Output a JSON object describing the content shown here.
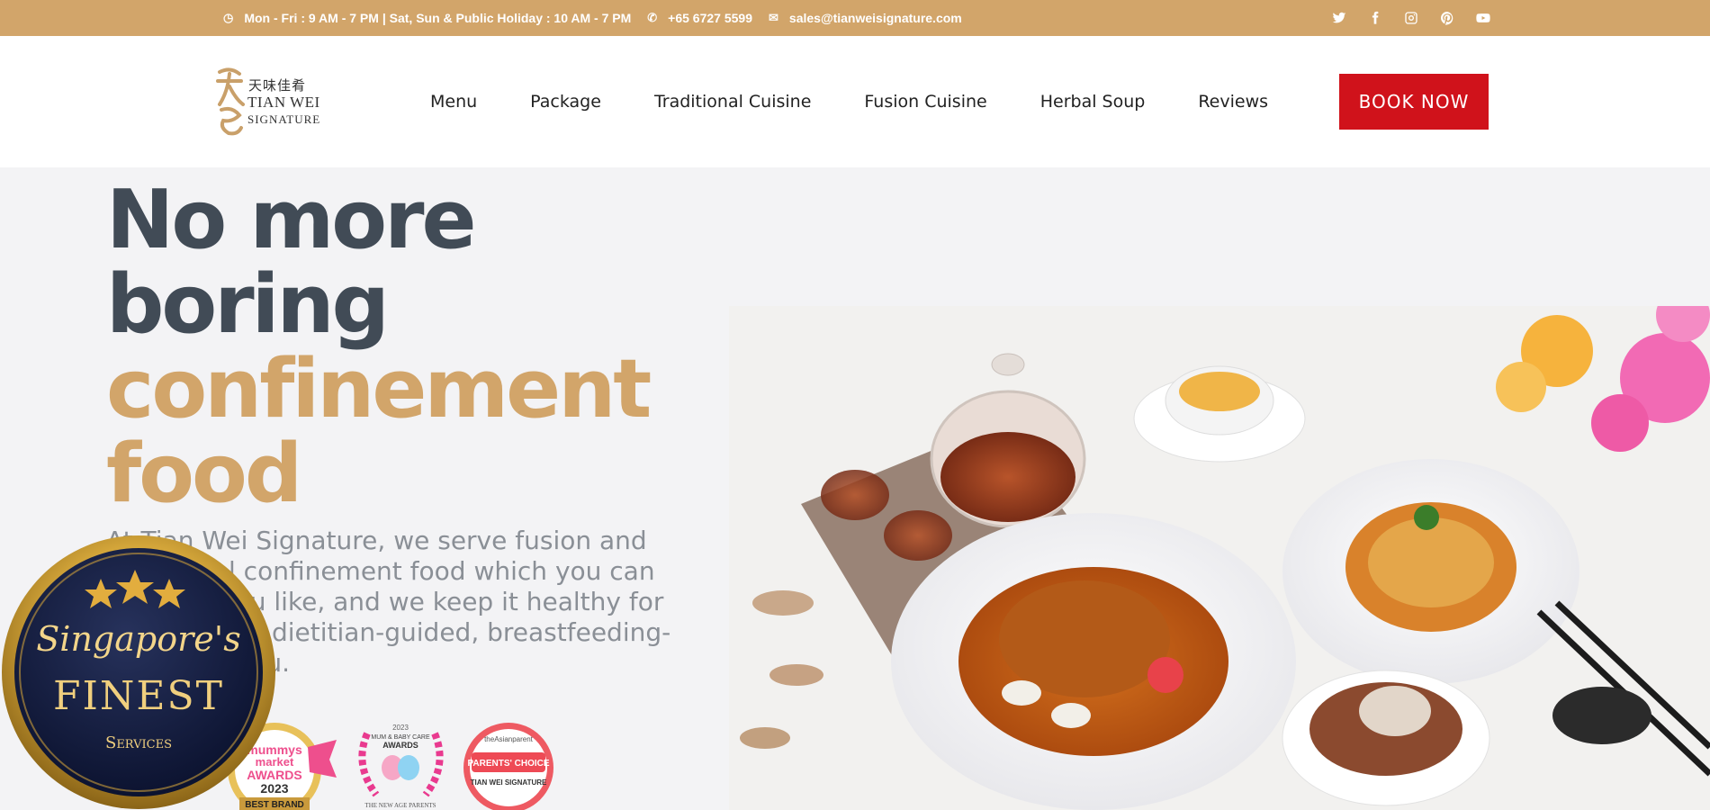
{
  "topbar": {
    "hours": "Mon - Fri : 9 AM - 7 PM | Sat, Sun & Public Holiday : 10 AM - 7 PM",
    "phone": "+65 6727 5599",
    "email": "sales@tianweisignature.com",
    "social_icons": [
      "twitter-icon",
      "facebook-icon",
      "instagram-icon",
      "pinterest-icon",
      "youtube-icon"
    ]
  },
  "logo": {
    "chinese": "天味佳肴",
    "line1": "TIAN WEI",
    "line2": "SIGNATURE"
  },
  "nav": {
    "items": [
      "Menu",
      "Package",
      "Traditional Cuisine",
      "Fusion Cuisine",
      "Herbal Soup",
      "Reviews"
    ],
    "book_label": "BOOK NOW"
  },
  "hero": {
    "line1": "No more",
    "line2": "boring",
    "line3": "confinement",
    "line4": "food",
    "description": "At Tian Wei Signature, we serve fusion and traditional confinement food which you can enjoy as you like, and we keep it healthy for you with our dietitian-guided, breastfeeding-friendly menu."
  },
  "awards": {
    "mummys": {
      "top": "mummys",
      "mid": "market",
      "label": "AWARDS",
      "year": "2023",
      "ribbon": "BEST BRAND"
    },
    "newage": {
      "year": "2023",
      "title1": "MUM & BABY CARE",
      "title2": "AWARDS",
      "footer": "THE NEW AGE PARENTS"
    },
    "parents": {
      "source": "theAsianparent",
      "label": "PARENTS' CHOICE",
      "brand": "TIAN WEI SIGNATURE"
    }
  },
  "badge": {
    "script": "Singapore's",
    "title": "FINEST",
    "subtitle": "Services"
  },
  "colors": {
    "gold": "#d2a56a",
    "book_red": "#d0121b",
    "heading_dark": "#414b56"
  }
}
